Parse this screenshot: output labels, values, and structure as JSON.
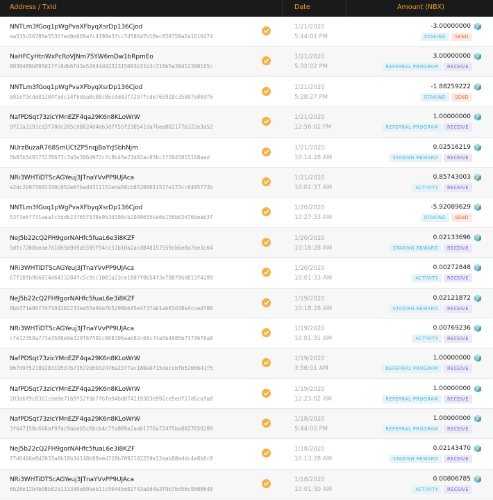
{
  "header": {
    "address_label": "Address / TxId",
    "date_label": "Date",
    "amount_label": "Amount (NBX)"
  },
  "colors": {
    "accent": "#f0a030",
    "header_bg": "#1a1a1a",
    "badge_type": "#4ab3d3",
    "badge_send": "#e06a45",
    "badge_receive": "#7b6bc8"
  },
  "icons": {
    "status": "check-circle-icon",
    "currency": "nbx-coin-icon"
  },
  "transactions": [
    {
      "address": "NNTLm3fGoq1pWgPvaXFbyqXsrDp136Cjod",
      "txid": "ea535d36786e5536fed0e069a7c4198a3fcc7d586d7b18ec859759a2a1616474",
      "date": "1/21/2020",
      "time": "5:44:01 PM",
      "amount": "-3.00000000",
      "type": "STAKING",
      "direction": "SEND"
    },
    {
      "address": "NaHFCyHtnWxPcRoVJNm75YW6mDw1bRpmEo",
      "txid": "8030d89b895017fc0db6fd2e52644d4232315093b31b3c310b5a38d12300165c",
      "date": "1/21/2020",
      "time": "5:32:02 PM",
      "amount": "3.00000000",
      "type": "REFERRAL PROGRAM",
      "direction": "RECEIVE"
    },
    {
      "address": "NNTLm3fGoq1pWgPvaXFbyqXsrDp136Cjod",
      "txid": "a91ef9cde81284fadc14fbdaa8c88c06c0d43f7297fcde765918c35007e80df6",
      "date": "1/21/2020",
      "time": "5:28:27 PM",
      "amount": "-1.88259222",
      "type": "STAKING",
      "direction": "SEND"
    },
    {
      "address": "NafPDSqt73zicYMnEZF4qa29K6n8KLoWrW",
      "txid": "9f11a3191cd3f70dc205cd8024d4e63d7f55f230541da76ea882177b322e3a52",
      "date": "1/21/2020",
      "time": "12:56:02 PM",
      "amount": "1.00000000",
      "type": "REFERRAL PROGRAM",
      "direction": "RECEIVE"
    },
    {
      "address": "NUrzBuzaR768SmUCtZP5nqjBaYrJSbhNjm",
      "txid": "5b93b549173278673c7a5e306d972c7c8b46e23d82ac03bc1f2045815168aad",
      "date": "1/21/2020",
      "time": "10:14:28 AM",
      "amount": "0.02516219",
      "type": "STAKING REWARD",
      "direction": "RECEIVE"
    },
    {
      "address": "NRi3WHTiDTScAGYeuj3JTnaYVvPP9UJAca",
      "txid": "e2dc2b973682330c052e0fbad4311151eda50cb85200611517e173cc6405773b",
      "date": "1/21/2020",
      "time": "10:01:37 AM",
      "amount": "0.85743003",
      "type": "ACTIVITY",
      "direction": "RECEIVE"
    },
    {
      "address": "NNTLm3fGoq1pWgPvaXFbyqXsrDp136Cjod",
      "txid": "53f3e6f731aea1c5ddb23f65f538e9b3d390cb2000655ba6e158b03d76beab3f",
      "date": "1/20/2020",
      "time": "10:27:33 AM",
      "amount": "-5.92089629",
      "type": "STAKING",
      "direction": "SEND"
    },
    {
      "address": "NeJ5b22cQ2FH9gorNAHfc5fuaL6e3i8KZF",
      "txid": "5dfc7208aeae7d1065b969a5595f94cc51b10a2acd84d157559cb6e8a7ee3c64",
      "date": "1/20/2020",
      "time": "10:16:28 AM",
      "amount": "0.02133696",
      "type": "STAKING REWARD",
      "direction": "RECEIVE"
    },
    {
      "address": "NRi3WHTiDTScAGYeuj3JTnaYVvPP9UJAca",
      "txid": "67f38fb966814d6433284fc5c9cc1001a23ce1807f0b54f3e708f06d813f4299",
      "date": "1/20/2020",
      "time": "10:01:33 AM",
      "amount": "0.00272848",
      "type": "ACTIVITY",
      "direction": "RECEIVE"
    },
    {
      "address": "NeJ5b22cQ2FH9gorNAHfc5fuaL6e3i8KZF",
      "txid": "0bb371e00f747194202233ee55e94e7b5298b645e4f37ab1ab63d38e4ccedf88",
      "date": "1/19/2020",
      "time": "10:18:28 AM",
      "amount": "0.02121872",
      "type": "STAKING REWARD",
      "direction": "RECEIVE"
    },
    {
      "address": "NRi3WHTiDTScAGYeuj3JTnaYVvPP9UJAca",
      "txid": "cfe12358a773e7588e9e329f67592c968396aab82c68c74a5b4085b73736f8a0",
      "date": "1/19/2020",
      "time": "10:01:31 AM",
      "amount": "0.00769236",
      "type": "ACTIVITY",
      "direction": "RECEIVE"
    },
    {
      "address": "NafPDSqt73zicYMnEZF4qa29K6n8KLoWrW",
      "txid": "867d9f5218928310537b73672d6932476a23ffac180a0715deccbfb5206b41f5",
      "date": "1/19/2020",
      "time": "3:56:01 AM",
      "amount": "1.00000000",
      "type": "REFERRAL PROGRAM",
      "direction": "RECEIVE"
    },
    {
      "address": "NafPDSqt73zicYMnEZF4qa29K6n8KLoWrW",
      "txid": "203a6f9c8361cde8e7169f52fdb7f6fa94bd874219383e992ce9edf17d6cafa8",
      "date": "1/19/2020",
      "time": "12:23:02 AM",
      "amount": "1.00000000",
      "type": "REFERRAL PROGRAM",
      "direction": "RECEIVE"
    },
    {
      "address": "NafPDSqt73zicYMnEZF4qa29K6n8KLoWrW",
      "txid": "3f647150c666af97ac9abeb5c6bcb4c7fa809a2aab1776a72475ba8027659289",
      "date": "1/18/2020",
      "time": "5:44:02 PM",
      "amount": "1.00000000",
      "type": "REFERRAL PROGRAM",
      "direction": "RECEIVE"
    },
    {
      "address": "NeJ5b22cQ2FH9gorNAHfc5fuaL6e3i8KZF",
      "txid": "77d6466e8d2033a0b18b34148b98aed728b7092102259e12aab88eddc4e8b6c8",
      "date": "1/18/2020",
      "time": "10:13:28 AM",
      "amount": "0.02143470",
      "type": "STAKING REWARD",
      "direction": "RECEIVE"
    },
    {
      "address": "NRi3WHTiDTScAGYeuj3JTnaYVvPP9UJAca",
      "txid": "6b28e12b4b08b82a1133d0e80aeb11c90445e02f43a0d4a3f9b7bd56c9508640",
      "date": "1/18/2020",
      "time": "10:01:30 AM",
      "amount": "0.00806785",
      "type": "ACTIVITY",
      "direction": "RECEIVE"
    }
  ]
}
